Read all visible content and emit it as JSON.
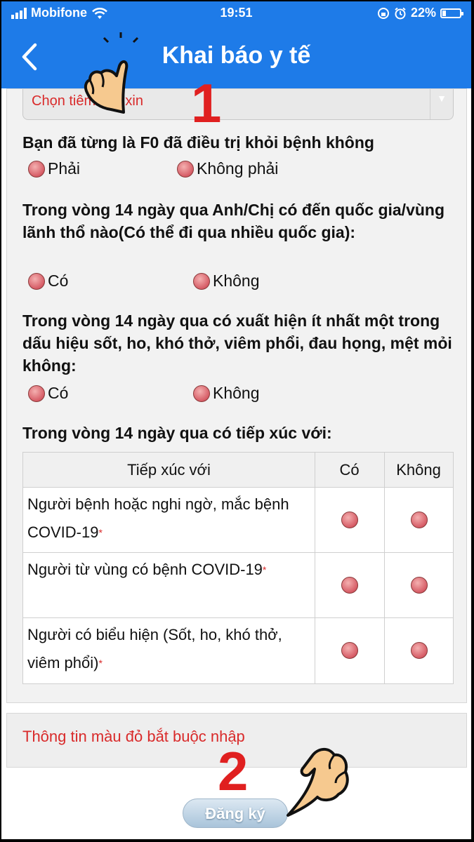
{
  "status_bar": {
    "carrier": "Mobifone",
    "time": "19:51",
    "battery": "22%",
    "battery_level": 0.22
  },
  "header": {
    "back_icon": "chevron-left-icon",
    "title": "Khai báo y tế"
  },
  "vaccine_select": {
    "value": "Chọn tiêm vắc xin"
  },
  "q_f0": {
    "text": "Bạn đã từng là F0 đã điều trị khỏi bệnh không",
    "options": [
      "Phải",
      "Không phải"
    ]
  },
  "q_travel": {
    "text": "Trong vòng 14 ngày qua Anh/Chị có đến quốc gia/vùng lãnh thổ nào(Có thể đi qua nhiều quốc gia):",
    "options": [
      "Có",
      "Không"
    ]
  },
  "q_symptoms": {
    "text": "Trong vòng 14 ngày qua có xuất hiện ít nhất một trong dấu hiệu sốt, ho, khó thở, viêm phổi, đau họng, mệt mỏi không:",
    "options": [
      "Có",
      "Không"
    ]
  },
  "q_contact": {
    "text": "Trong vòng 14 ngày qua có tiếp xúc với:",
    "headers": [
      "Tiếp xúc với",
      "Có",
      "Không"
    ],
    "rows": [
      {
        "label": "Người bệnh hoặc nghi ngờ, mắc bệnh COVID-19",
        "required_mark": "*"
      },
      {
        "label": "Người từ vùng có bệnh COVID-19",
        "required_mark": "*"
      },
      {
        "label": "Người có biểu hiện (Sốt, ho, khó thở, viêm phổi)",
        "required_mark": "*"
      }
    ]
  },
  "note": "Thông tin màu đỏ bắt buộc nhập",
  "register_button": "Đăng ký",
  "annotations": {
    "step1": "1",
    "step2": "2"
  },
  "colors": {
    "header": "#1e7be8",
    "required": "#d92a2a",
    "annotation": "#e02020"
  }
}
